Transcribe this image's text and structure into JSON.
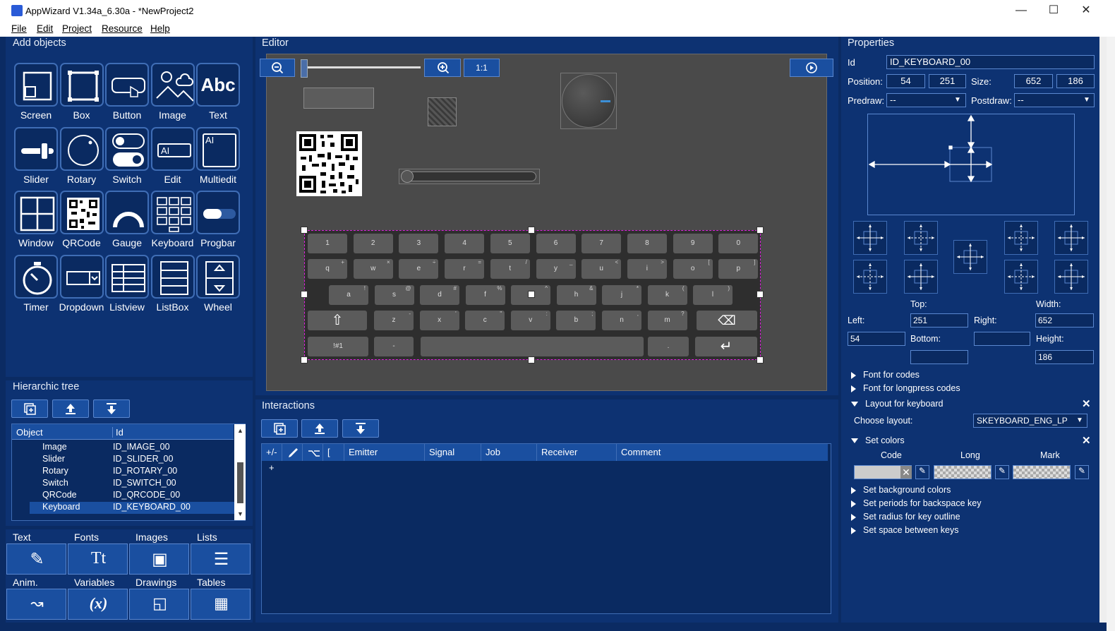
{
  "window": {
    "title": "AppWizard V1.34a_6.30a - *NewProject2",
    "minimize": "—",
    "maximize": "☐",
    "close": "✕"
  },
  "menu": [
    "File",
    "Edit",
    "Project",
    "Resource",
    "Help"
  ],
  "add_objects": {
    "title": "Add objects",
    "items": [
      {
        "label": "Screen",
        "icon": "screen-icon"
      },
      {
        "label": "Box",
        "icon": "box-icon"
      },
      {
        "label": "Button",
        "icon": "button-icon"
      },
      {
        "label": "Image",
        "icon": "image-icon"
      },
      {
        "label": "Text",
        "icon": "text-icon",
        "glyph": "Abc"
      },
      {
        "label": "Slider",
        "icon": "slider-icon"
      },
      {
        "label": "Rotary",
        "icon": "rotary-icon"
      },
      {
        "label": "Switch",
        "icon": "switch-icon"
      },
      {
        "label": "Edit",
        "icon": "edit-icon",
        "glyph": "AI"
      },
      {
        "label": "Multiedit",
        "icon": "multiedit-icon",
        "glyph": "AI"
      },
      {
        "label": "Window",
        "icon": "window-icon"
      },
      {
        "label": "QRCode",
        "icon": "qrcode-icon"
      },
      {
        "label": "Gauge",
        "icon": "gauge-icon"
      },
      {
        "label": "Keyboard",
        "icon": "keyboard-icon"
      },
      {
        "label": "Progbar",
        "icon": "progbar-icon"
      },
      {
        "label": "Timer",
        "icon": "timer-icon"
      },
      {
        "label": "Dropdown",
        "icon": "dropdown-icon"
      },
      {
        "label": "Listview",
        "icon": "listview-icon"
      },
      {
        "label": "ListBox",
        "icon": "listbox-icon"
      },
      {
        "label": "Wheel",
        "icon": "wheel-icon"
      }
    ]
  },
  "tree": {
    "title": "Hierarchic tree",
    "col_object": "Object",
    "col_id": "Id",
    "rows": [
      {
        "object": "Image",
        "id": "ID_IMAGE_00"
      },
      {
        "object": "Slider",
        "id": "ID_SLIDER_00"
      },
      {
        "object": "Rotary",
        "id": "ID_ROTARY_00"
      },
      {
        "object": "Switch",
        "id": "ID_SWITCH_00"
      },
      {
        "object": "QRCode",
        "id": "ID_QRCODE_00"
      },
      {
        "object": "Keyboard",
        "id": "ID_KEYBOARD_00",
        "selected": true
      }
    ]
  },
  "bottom_tabs": {
    "row1": [
      "Text",
      "Fonts",
      "Images",
      "Lists"
    ],
    "row2": [
      "Anim.",
      "Variables",
      "Drawings",
      "Tables"
    ],
    "variables_glyph": "(x)",
    "fonts_glyph": "Tt"
  },
  "editor": {
    "title": "Editor",
    "zoom_reset": "1:1",
    "slider_value": 0.05,
    "keyboard": {
      "row1": [
        "1",
        "2",
        "3",
        "4",
        "5",
        "6",
        "7",
        "8",
        "9",
        "0"
      ],
      "row2": [
        [
          "q",
          "+"
        ],
        [
          "w",
          "×"
        ],
        [
          "e",
          "÷"
        ],
        [
          "r",
          "="
        ],
        [
          "t",
          "/"
        ],
        [
          "y",
          "_"
        ],
        [
          "u",
          "<"
        ],
        [
          "i",
          ">"
        ],
        [
          "o",
          "["
        ],
        [
          "p",
          "]"
        ]
      ],
      "row3": [
        [
          "a",
          "!"
        ],
        [
          "s",
          "@"
        ],
        [
          "d",
          "#"
        ],
        [
          "f",
          "%"
        ],
        [
          "g",
          "^"
        ],
        [
          "h",
          "&"
        ],
        [
          "j",
          "*"
        ],
        [
          "k",
          "("
        ],
        [
          "l",
          ")"
        ]
      ],
      "row4": [
        [
          "z",
          "-"
        ],
        [
          "x",
          "'"
        ],
        [
          "c",
          "\""
        ],
        [
          "v",
          ":"
        ],
        [
          "b",
          ";"
        ],
        [
          "n",
          ","
        ],
        [
          "m",
          "?"
        ]
      ],
      "symbols_key": "!#1",
      "dash_key": "-",
      "dot_key": "."
    }
  },
  "interactions": {
    "title": "Interactions",
    "columns": [
      "+/-",
      "",
      "",
      "[",
      "Emitter",
      "Signal",
      "Job",
      "Receiver",
      "Comment"
    ],
    "add_row": "+"
  },
  "properties": {
    "title": "Properties",
    "id_label": "Id",
    "id_value": "ID_KEYBOARD_00",
    "position_label": "Position:",
    "pos_x": "54",
    "pos_y": "251",
    "size_label": "Size:",
    "size_w": "652",
    "size_h": "186",
    "predraw_label": "Predraw:",
    "predraw_value": "--",
    "postdraw_label": "Postdraw:",
    "postdraw_value": "--",
    "top_label": "Top:",
    "top_value": "251",
    "width_label": "Width:",
    "width_value": "652",
    "left_label": "Left:",
    "left_value": "54",
    "right_label": "Right:",
    "bottom_label": "Bottom:",
    "height_label": "Height:",
    "height_value": "186",
    "sections": {
      "font_codes": "Font for codes",
      "font_longpress": "Font for longpress codes",
      "layout": "Layout for keyboard",
      "choose_layout_label": "Choose layout:",
      "choose_layout_value": "SKEYBOARD_ENG_LP",
      "set_colors": "Set colors",
      "col_code": "Code",
      "col_long": "Long",
      "col_mark": "Mark",
      "bg_colors": "Set background colors",
      "periods": "Set periods for backspace key",
      "radius": "Set radius for key outline",
      "space": "Set space between keys"
    }
  },
  "colors": {
    "app_bg": "#0b2b63",
    "panel": "#0d3272",
    "accent": "#1a4fa0",
    "selection": "#e020e0",
    "editor_bg": "#4a4a4a"
  }
}
